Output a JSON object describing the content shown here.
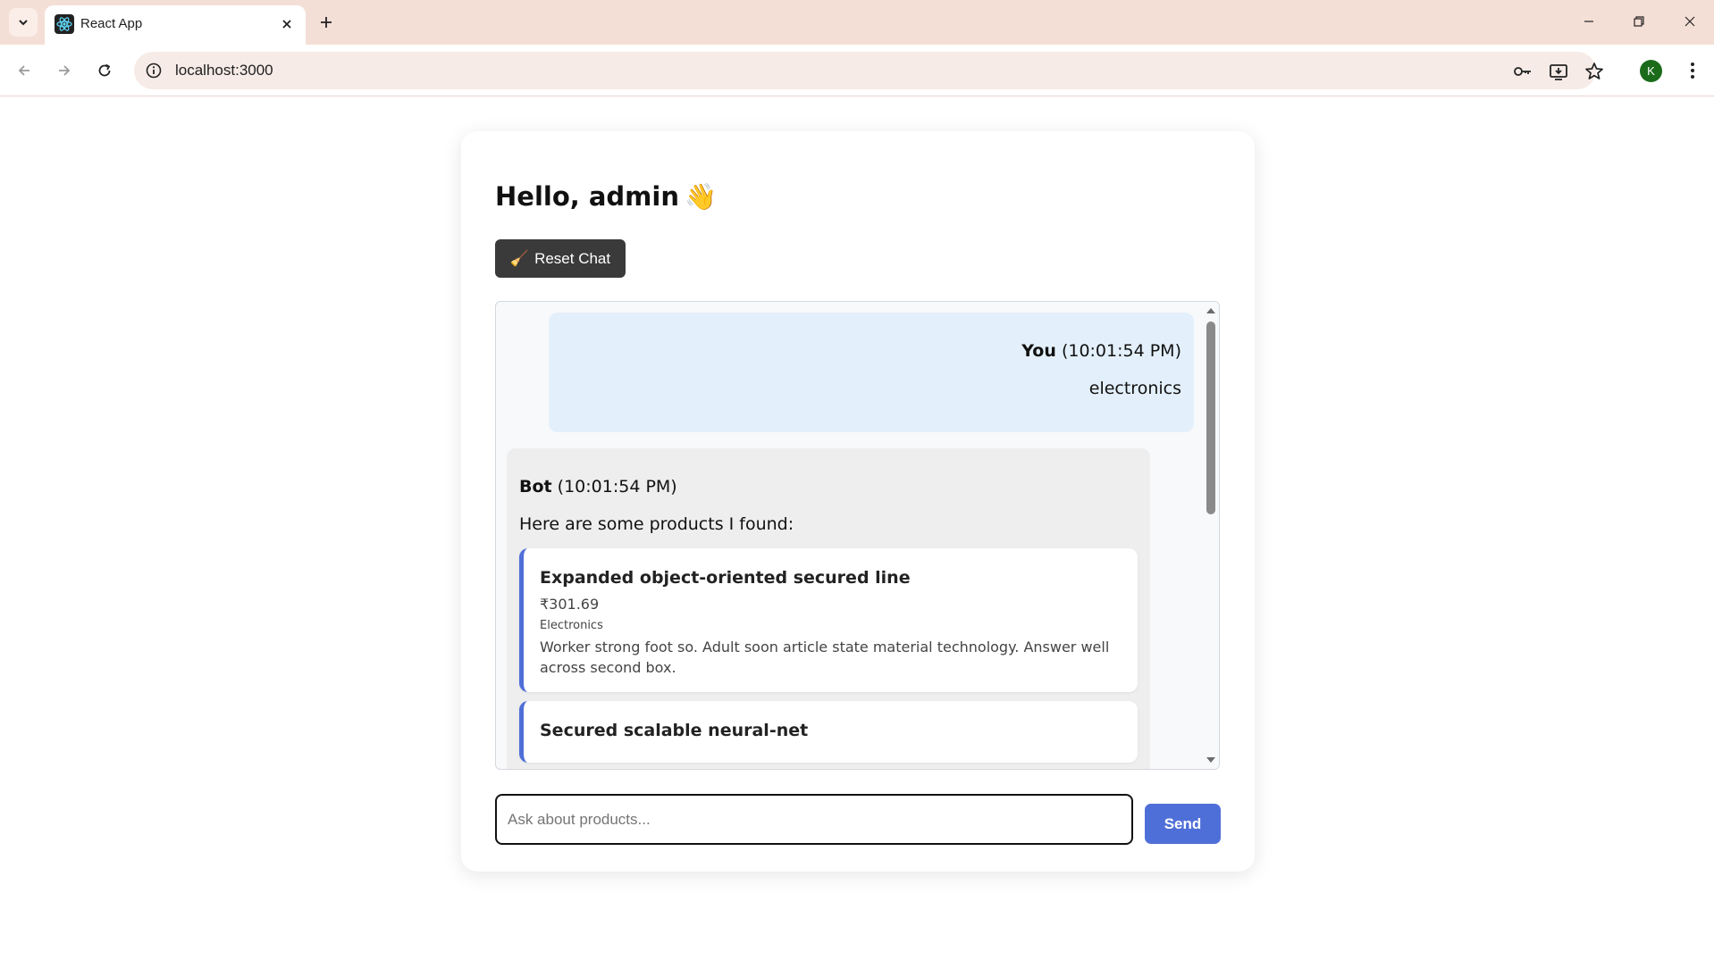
{
  "browser": {
    "tab_title": "React App",
    "url": "localhost:3000",
    "profile_initial": "K"
  },
  "page": {
    "greeting": "Hello, admin",
    "greeting_emoji": "👋",
    "reset_label": "Reset Chat",
    "reset_emoji": "🧹",
    "input_placeholder": "Ask about products...",
    "send_label": "Send"
  },
  "messages": [
    {
      "sender": "You",
      "time": "(10:01:54 PM)",
      "text": "electronics"
    },
    {
      "sender": "Bot",
      "time": "(10:01:54 PM)",
      "text": "Here are some products I found:"
    }
  ],
  "products": [
    {
      "name": "Expanded object-oriented secured line",
      "price": "₹301.69",
      "category": "Electronics",
      "description": "Worker strong foot so. Adult soon article state material technology. Answer well across second box."
    },
    {
      "name": "Secured scalable neural-net",
      "price": "",
      "category": "",
      "description": ""
    }
  ],
  "colors": {
    "accent": "#4f6fd8",
    "user_bubble": "#e3f0fb",
    "bot_bubble": "#eeeeee",
    "reset_button": "#3a3a3a"
  }
}
